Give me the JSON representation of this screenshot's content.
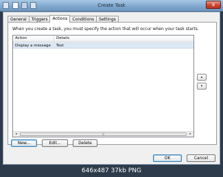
{
  "window": {
    "title": "Create Task",
    "close_glyph": "x"
  },
  "tabs": [
    {
      "label": "General"
    },
    {
      "label": "Triggers"
    },
    {
      "label": "Actions"
    },
    {
      "label": "Conditions"
    },
    {
      "label": "Settings"
    }
  ],
  "active_tab": "Actions",
  "actions_panel": {
    "intro": "When you create a task, you must specify the action that will occur when your task starts.",
    "columns": [
      "Action",
      "Details"
    ],
    "rows": [
      {
        "action": "Display a message",
        "details": "Test"
      }
    ],
    "scroll_grip": "|||",
    "scroll_left_glyph": "◂",
    "scroll_right_glyph": "▸",
    "move_up_glyph": "▴",
    "move_down_glyph": "▾"
  },
  "buttons": {
    "new": "New...",
    "edit": "Edit...",
    "delete": "Delete",
    "ok": "OK",
    "cancel": "Cancel"
  },
  "image_caption": "646x487  37kb  PNG"
}
